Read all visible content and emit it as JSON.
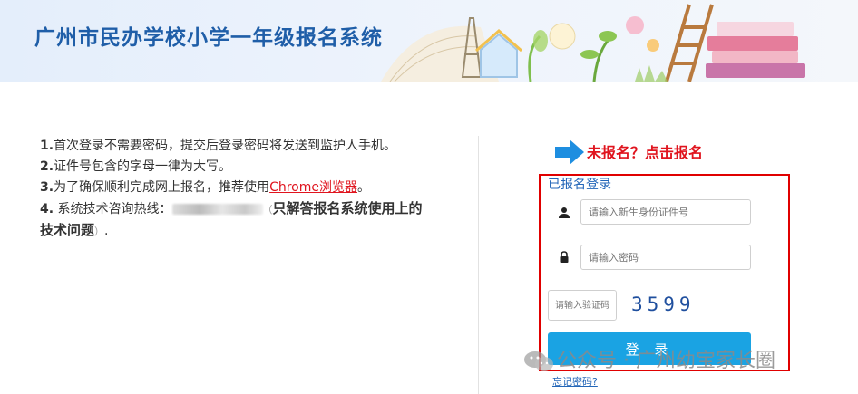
{
  "header": {
    "title": "广州市民办学校小学一年级报名系统"
  },
  "instructions": {
    "item1_num": "1.",
    "item1_text": "首次登录不需要密码，提交后登录密码将发送到监护人手机。",
    "item2_num": "2.",
    "item2_text": "证件号包含的字母一律为大写。",
    "item3_num": "3.",
    "item3_text": "为了确保顺利完成网上报名，推荐使用",
    "item3_link": "Chrome浏览器",
    "item3_end": "。",
    "item4_num": "4.",
    "item4_text": " 系统技术咨询热线：",
    "item4_paren_open": "（",
    "item4_bold": "只解答报名系统使用上的技术问题",
    "item4_paren_close": "）",
    "item4_end": "."
  },
  "register": {
    "link_label": "未报名？点击报名"
  },
  "login": {
    "heading": "已报名登录",
    "id_placeholder": "请输入新生身份证件号",
    "password_placeholder": "请输入密码",
    "captcha_placeholder": "请输入验证码",
    "captcha_code": "3599",
    "submit_label": "登 录",
    "forgot_label": "忘记密码?"
  },
  "watermark": {
    "text": "公众号 · 广州幼宝家长圈"
  },
  "colors": {
    "title_blue": "#1f5ea8",
    "accent_red": "#e0141e",
    "button_blue": "#1aa3e3",
    "box_red": "#e00000"
  }
}
